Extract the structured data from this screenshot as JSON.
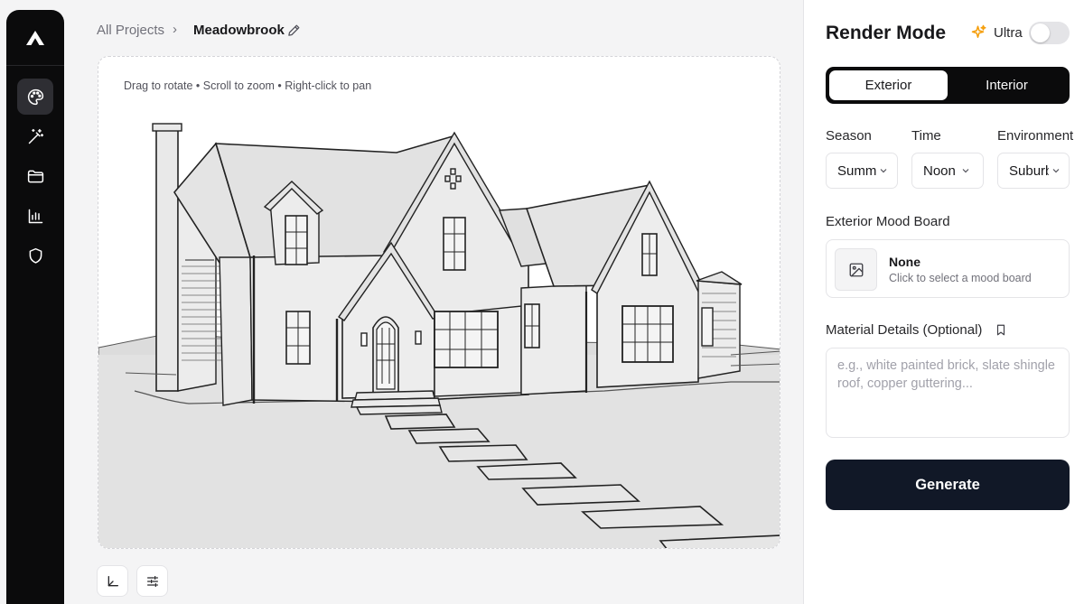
{
  "sidebar": {
    "logo": "app-logo",
    "items": [
      {
        "icon": "palette-icon",
        "active": true
      },
      {
        "icon": "magic-wand-icon",
        "active": false
      },
      {
        "icon": "folder-icon",
        "active": false
      },
      {
        "icon": "bar-chart-icon",
        "active": false
      },
      {
        "icon": "shield-icon",
        "active": false
      }
    ]
  },
  "breadcrumb": {
    "root": "All Projects",
    "separator": "›",
    "current": "Meadowbrook"
  },
  "canvas": {
    "hint": "Drag to rotate • Scroll to zoom • Right-click to pan",
    "tools": [
      "axes-icon",
      "sliders-icon"
    ]
  },
  "panel": {
    "title": "Render Mode",
    "ultra_label": "Ultra",
    "ultra_enabled": false,
    "modes": {
      "exterior": "Exterior",
      "interior": "Interior",
      "selected": "Exterior"
    },
    "season": {
      "label": "Season",
      "value": "Summ"
    },
    "time": {
      "label": "Time",
      "value": "Noon"
    },
    "environment": {
      "label": "Environment",
      "value": "Suburb"
    },
    "mood_board": {
      "label": "Exterior Mood Board",
      "title": "None",
      "subtitle": "Click to select a mood board"
    },
    "material": {
      "label": "Material Details (Optional)",
      "placeholder": "e.g., white painted brick, slate shingle roof, copper guttering..."
    },
    "generate_label": "Generate"
  },
  "colors": {
    "sidebar_bg": "#0b0b0c",
    "accent_dark": "#111827",
    "sparkle": "#f59e0b"
  }
}
